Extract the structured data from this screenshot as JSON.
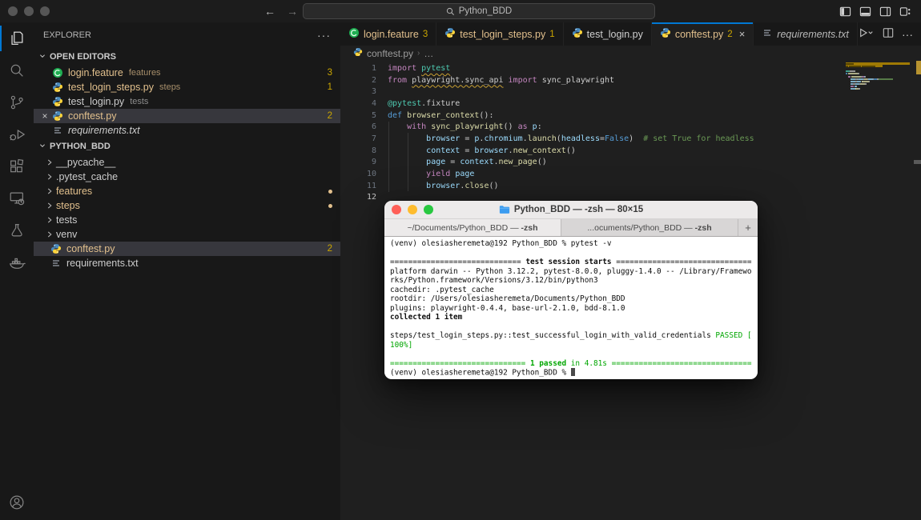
{
  "colors": {
    "accent_blue": "#0078d4",
    "modified_gold": "#e2c08d",
    "badge_yellow": "#cca700",
    "terminal_green": "#00a600",
    "warning_squiggle": "#c8a032",
    "selection_gray": "#37373d"
  },
  "titlebar": {
    "search_text": "Python_BDD",
    "back": "←",
    "forward": "→"
  },
  "activity_bar": {
    "items": [
      {
        "name": "explorer",
        "active": true
      },
      {
        "name": "search",
        "active": false
      },
      {
        "name": "source-control",
        "active": false
      },
      {
        "name": "run-debug",
        "active": false
      },
      {
        "name": "extensions",
        "active": false
      },
      {
        "name": "remote-explorer",
        "active": false
      },
      {
        "name": "testing",
        "active": false
      },
      {
        "name": "docker",
        "active": false
      }
    ],
    "account": "account"
  },
  "sidebar": {
    "title": "EXPLORER",
    "more": "···",
    "open_editors_header": "OPEN EDITORS",
    "open_editors": [
      {
        "icon": "gherkin",
        "name": "login.feature",
        "detail": "features",
        "badge": "3",
        "state": "modified",
        "selected": false,
        "close": false,
        "italic": false
      },
      {
        "icon": "python",
        "name": "test_login_steps.py",
        "detail": "steps",
        "badge": "1",
        "state": "modified",
        "selected": false,
        "close": false,
        "italic": false
      },
      {
        "icon": "python",
        "name": "test_login.py",
        "detail": "tests",
        "badge": "",
        "state": "normal",
        "selected": false,
        "close": false,
        "italic": false
      },
      {
        "icon": "python",
        "name": "conftest.py",
        "detail": "",
        "badge": "2",
        "state": "modified",
        "selected": true,
        "close": true,
        "italic": false
      },
      {
        "icon": "txt",
        "name": "requirements.txt",
        "detail": "",
        "badge": "",
        "state": "normal",
        "selected": false,
        "close": false,
        "italic": true
      }
    ],
    "project_header": "PYTHON_BDD",
    "project": [
      {
        "kind": "folder",
        "name": "__pycache__",
        "state": "normal",
        "dot": false
      },
      {
        "kind": "folder",
        "name": ".pytest_cache",
        "state": "normal",
        "dot": false
      },
      {
        "kind": "folder",
        "name": "features",
        "state": "modified",
        "dot": true
      },
      {
        "kind": "folder",
        "name": "steps",
        "state": "modified",
        "dot": true
      },
      {
        "kind": "folder",
        "name": "tests",
        "state": "normal",
        "dot": false
      },
      {
        "kind": "folder",
        "name": "venv",
        "state": "normal",
        "dot": false
      },
      {
        "kind": "file",
        "icon": "python",
        "name": "conftest.py",
        "badge": "2",
        "state": "modified",
        "selected": true
      },
      {
        "kind": "file",
        "icon": "txt",
        "name": "requirements.txt",
        "badge": "",
        "state": "normal",
        "selected": false
      }
    ]
  },
  "tabs": [
    {
      "icon": "gherkin",
      "label": "login.feature",
      "badge": "3",
      "state": "modified",
      "active": false,
      "close": "",
      "italic": false
    },
    {
      "icon": "python",
      "label": "test_login_steps.py",
      "badge": "1",
      "state": "modified",
      "active": false,
      "close": "",
      "italic": false
    },
    {
      "icon": "python",
      "label": "test_login.py",
      "badge": "",
      "state": "normal",
      "active": false,
      "close": "",
      "italic": false
    },
    {
      "icon": "python",
      "label": "conftest.py",
      "badge": "2",
      "state": "modified",
      "active": true,
      "close": "×",
      "italic": false
    },
    {
      "icon": "txt",
      "label": "requirements.txt",
      "badge": "",
      "state": "normal",
      "active": false,
      "close": "",
      "italic": true
    }
  ],
  "editor_actions": {
    "more": "···"
  },
  "breadcrumb": {
    "file": "conftest.py",
    "sep": "›",
    "more": "…"
  },
  "code": {
    "lines": [
      [
        {
          "c": "kw",
          "t": "import"
        },
        {
          "c": "tx",
          "t": " "
        },
        {
          "c": "ty",
          "t": "pytest",
          "u": true
        }
      ],
      [
        {
          "c": "kw",
          "t": "from"
        },
        {
          "c": "tx",
          "t": " "
        },
        {
          "c": "tx",
          "t": "playwright.sync_api",
          "u": true
        },
        {
          "c": "tx",
          "t": " "
        },
        {
          "c": "kw",
          "t": "import"
        },
        {
          "c": "tx",
          "t": " sync_playwright"
        }
      ],
      [],
      [
        {
          "c": "ty",
          "t": "@pytest"
        },
        {
          "c": "tx",
          "t": ".fixture"
        }
      ],
      [
        {
          "c": "df",
          "t": "def"
        },
        {
          "c": "tx",
          "t": " "
        },
        {
          "c": "fn",
          "t": "browser_context"
        },
        {
          "c": "tx",
          "t": "():"
        }
      ],
      [
        {
          "c": "tx",
          "t": "    "
        },
        {
          "c": "kw",
          "t": "with"
        },
        {
          "c": "tx",
          "t": " "
        },
        {
          "c": "fn",
          "t": "sync_playwright"
        },
        {
          "c": "tx",
          "t": "() "
        },
        {
          "c": "kw",
          "t": "as"
        },
        {
          "c": "tx",
          "t": " "
        },
        {
          "c": "vr",
          "t": "p"
        },
        {
          "c": "tx",
          "t": ":"
        }
      ],
      [
        {
          "c": "tx",
          "t": "        "
        },
        {
          "c": "vr",
          "t": "browser"
        },
        {
          "c": "tx",
          "t": " = "
        },
        {
          "c": "vr",
          "t": "p"
        },
        {
          "c": "tx",
          "t": "."
        },
        {
          "c": "vr",
          "t": "chromium"
        },
        {
          "c": "tx",
          "t": "."
        },
        {
          "c": "fn",
          "t": "launch"
        },
        {
          "c": "tx",
          "t": "("
        },
        {
          "c": "vr",
          "t": "headless"
        },
        {
          "c": "tx",
          "t": "="
        },
        {
          "c": "df",
          "t": "False"
        },
        {
          "c": "tx",
          "t": ")  "
        },
        {
          "c": "cm",
          "t": "# set True for headless"
        }
      ],
      [
        {
          "c": "tx",
          "t": "        "
        },
        {
          "c": "vr",
          "t": "context"
        },
        {
          "c": "tx",
          "t": " = "
        },
        {
          "c": "vr",
          "t": "browser"
        },
        {
          "c": "tx",
          "t": "."
        },
        {
          "c": "fn",
          "t": "new_context"
        },
        {
          "c": "tx",
          "t": "()"
        }
      ],
      [
        {
          "c": "tx",
          "t": "        "
        },
        {
          "c": "vr",
          "t": "page"
        },
        {
          "c": "tx",
          "t": " = "
        },
        {
          "c": "vr",
          "t": "context"
        },
        {
          "c": "tx",
          "t": "."
        },
        {
          "c": "fn",
          "t": "new_page"
        },
        {
          "c": "tx",
          "t": "()"
        }
      ],
      [
        {
          "c": "tx",
          "t": "        "
        },
        {
          "c": "kw",
          "t": "yield"
        },
        {
          "c": "tx",
          "t": " "
        },
        {
          "c": "vr",
          "t": "page"
        }
      ],
      [
        {
          "c": "tx",
          "t": "        "
        },
        {
          "c": "vr",
          "t": "browser"
        },
        {
          "c": "tx",
          "t": "."
        },
        {
          "c": "fn",
          "t": "close"
        },
        {
          "c": "tx",
          "t": "()"
        }
      ],
      []
    ],
    "current_line": 12,
    "minimap_highlights": [
      {
        "line": 0,
        "w": 80
      },
      {
        "line": 1,
        "w": 46
      }
    ]
  },
  "terminal": {
    "title": "Python_BDD — -zsh — 80×15",
    "tabs": [
      {
        "path": "~/Documents/Python_BDD — ",
        "shell": "-zsh",
        "active": true
      },
      {
        "path": "...ocuments/Python_BDD — ",
        "shell": "-zsh",
        "active": false
      }
    ],
    "new_tab": "+",
    "rows": [
      [
        {
          "t": "(venv) olesiasheremeta@192 Python_BDD % pytest -v"
        }
      ],
      [],
      [
        {
          "t": "============================="
        },
        {
          "t": " test session starts ",
          "s": "b"
        },
        {
          "t": "=============================="
        }
      ],
      [
        {
          "t": "platform darwin -- Python 3.12.2, pytest-8.0.0, pluggy-1.4.0 -- /Library/Framewo"
        }
      ],
      [
        {
          "t": "rks/Python.framework/Versions/3.12/bin/python3"
        }
      ],
      [
        {
          "t": "cachedir: .pytest_cache"
        }
      ],
      [
        {
          "t": "rootdir: /Users/olesiasheremeta/Documents/Python_BDD"
        }
      ],
      [
        {
          "t": "plugins: playwright-0.4.4, base-url-2.1.0, bdd-8.1.0"
        }
      ],
      [
        {
          "t": "collected 1 item",
          "s": "b"
        }
      ],
      [],
      [
        {
          "t": "steps/test_login_steps.py::test_successful_login_with_valid_credentials "
        },
        {
          "t": "PASSED",
          "s": "g"
        },
        {
          "t": " "
        },
        {
          "t": "[",
          "s": "g"
        }
      ],
      [
        {
          "t": "100%]",
          "s": "g"
        }
      ],
      [],
      [
        {
          "t": "==============================",
          "s": "g"
        },
        {
          "t": " 1 passed",
          "s": "gb"
        },
        {
          "t": " in 4.81s ",
          "s": "g"
        },
        {
          "t": "===============================",
          "s": "g"
        }
      ],
      [
        {
          "t": "(venv) olesiasheremeta@192 Python_BDD % ",
          "cursor": true
        }
      ]
    ]
  }
}
